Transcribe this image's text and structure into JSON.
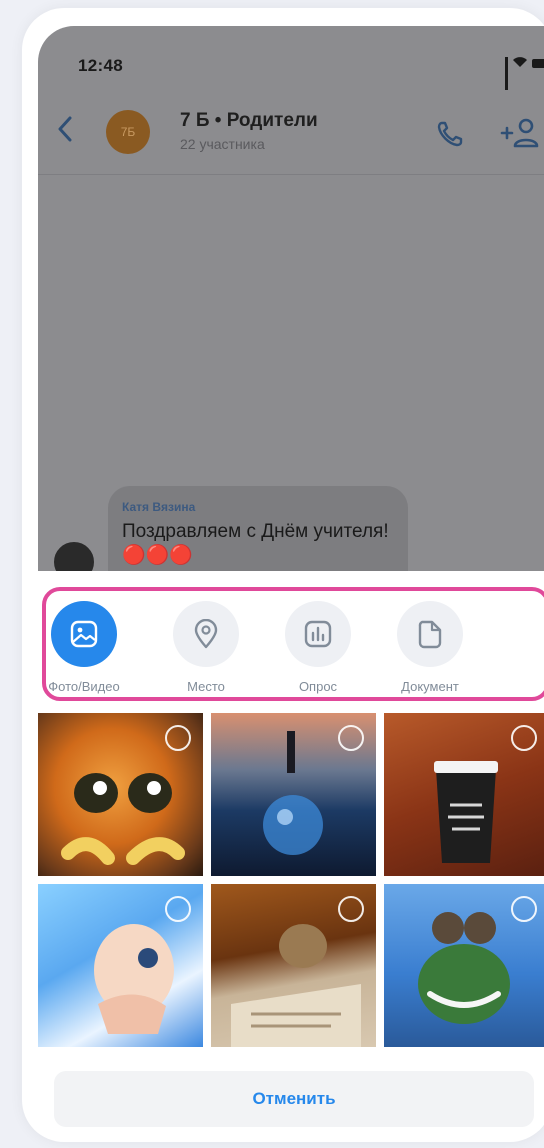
{
  "status_bar": {
    "time": "12:48"
  },
  "header": {
    "avatar_initials": "7Б",
    "title": "7 Б • Родители",
    "subtitle": "22 участника"
  },
  "message": {
    "author": "Катя Вязина",
    "text": "Поздравляем с Днём учителя!🔴🔴🔴"
  },
  "attach_options": [
    {
      "label": "Фото/Видео",
      "icon": "image-icon",
      "active": true
    },
    {
      "label": "Место",
      "icon": "location-pin-icon",
      "active": false
    },
    {
      "label": "Опрос",
      "icon": "poll-icon",
      "active": false
    },
    {
      "label": "Документ",
      "icon": "document-icon",
      "active": false
    }
  ],
  "gallery": {
    "photos": [
      {
        "subject": "cartoon cat"
      },
      {
        "subject": "glass ball on beach"
      },
      {
        "subject": "coffee cup in autumn leaves"
      },
      {
        "subject": "cartoon girl"
      },
      {
        "subject": "cat on newspapers"
      },
      {
        "subject": "cartoon frog with goggles"
      }
    ]
  },
  "cancel_label": "Отменить",
  "colors": {
    "accent": "#2688eb",
    "highlight_border": "#e0499a",
    "overlay": "#8c8c8f"
  }
}
